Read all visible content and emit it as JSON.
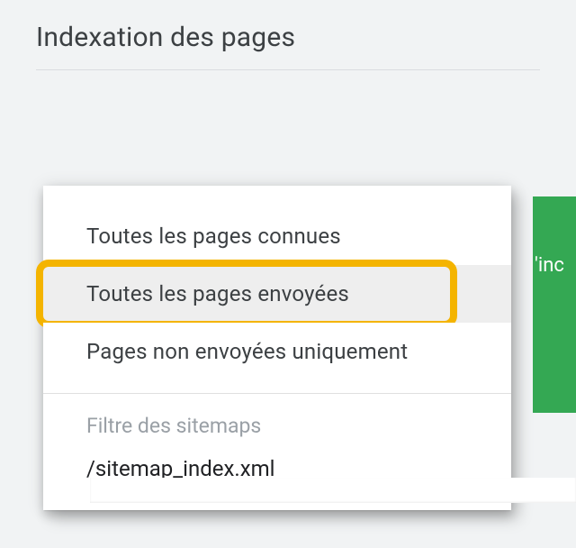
{
  "header": {
    "title": "Indexation des pages"
  },
  "dropdown": {
    "items": [
      {
        "label": "Toutes les pages connues",
        "selected": false
      },
      {
        "label": "Toutes les pages envoyées",
        "selected": true
      },
      {
        "label": "Pages non envoyées uniquement",
        "selected": false
      }
    ],
    "sitemap_section_label": "Filtre des sitemaps",
    "sitemap_path": "/sitemap_index.xml"
  },
  "green_tab": {
    "text_fragment": "'inc"
  }
}
